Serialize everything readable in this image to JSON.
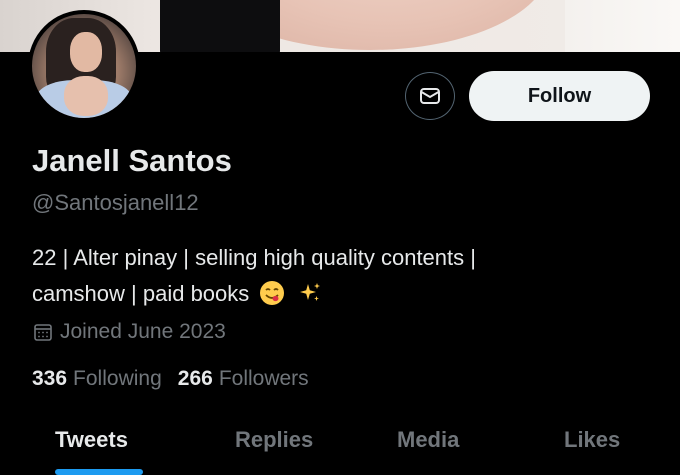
{
  "profile": {
    "name": "Janell Santos",
    "handle": "@Santosjanell12",
    "bio_line1": "22 | Alter pinay | selling high quality contents |",
    "bio_line2": "camshow | paid books",
    "joined": "Joined June 2023"
  },
  "stats": {
    "following_count": "336",
    "following_label": "Following",
    "followers_count": "266",
    "followers_label": "Followers"
  },
  "actions": {
    "follow_label": "Follow",
    "message_icon": "envelope-icon"
  },
  "tabs": [
    {
      "label": "Tweets",
      "active": true
    },
    {
      "label": "Replies",
      "active": false
    },
    {
      "label": "Media",
      "active": false
    },
    {
      "label": "Likes",
      "active": false
    }
  ],
  "colors": {
    "background": "#000000",
    "primary_text": "#e7e9ea",
    "secondary_text": "#71767b",
    "accent": "#1d9bf0",
    "follow_button_bg": "#eff3f4"
  }
}
